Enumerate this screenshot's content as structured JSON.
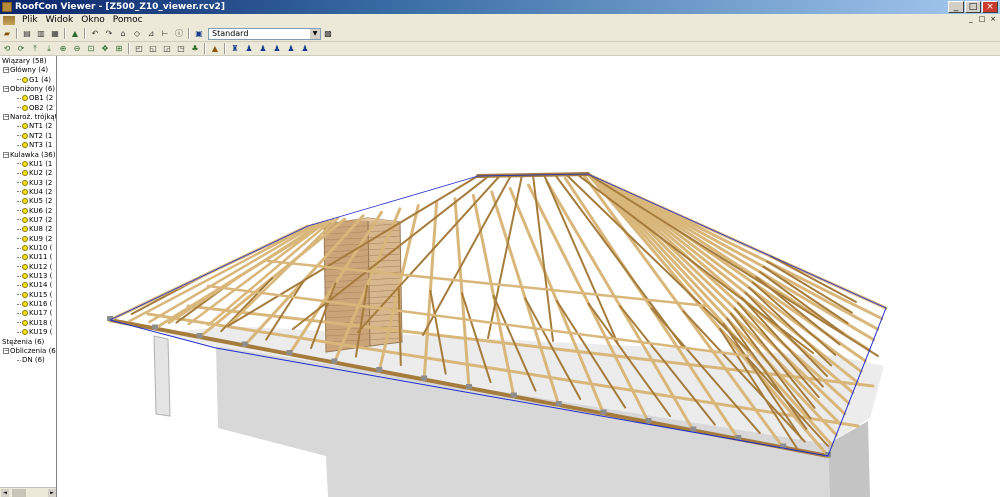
{
  "window": {
    "title": "RoofCon Viewer - [Z500_Z10_viewer.rcv2]",
    "buttons": [
      "_",
      "□",
      "×"
    ]
  },
  "menu": {
    "items": [
      "Plik",
      "Widok",
      "Okno",
      "Pomoc"
    ],
    "mdi_buttons": [
      "_",
      "□",
      "×"
    ]
  },
  "toolbar": {
    "view_select": "Standard"
  },
  "tree": {
    "root_label": "Wiązary (58)",
    "groups": [
      {
        "label": "Główny (4)",
        "items": [
          "G1 (4)"
        ]
      },
      {
        "label": "Obniżony (6)",
        "items": [
          "OB1 (2",
          "OB2 (2"
        ]
      },
      {
        "label": "Naroż. trójkąt",
        "items": [
          "NT1 (2",
          "NT2 (1",
          "NT3 (1"
        ]
      },
      {
        "label": "Kulawka (36)",
        "items": [
          "KU1 (1",
          "KU2 (2",
          "KU3 (2",
          "KU4 (2",
          "KU5 (2",
          "KU6 (2",
          "KU7 (2",
          "KU8 (2",
          "KU9 (2",
          "KU10 (",
          "KU11 (",
          "KU12 (",
          "KU13 (",
          "KU14 (",
          "KU15 (",
          "KU16 (",
          "KU17 (",
          "KU18 (",
          "KU19 ("
        ]
      }
    ],
    "bracing_label": "Stężenia (6)",
    "bracing_group": "Obliczenia (6",
    "bracing_item": "DN (6)"
  },
  "colors": {
    "timber": "#d9b77a",
    "timber_dark": "#a57c3c",
    "brick": "#c9a27a",
    "wall": "#d9d9d9",
    "outline": "#1f2ccf"
  }
}
